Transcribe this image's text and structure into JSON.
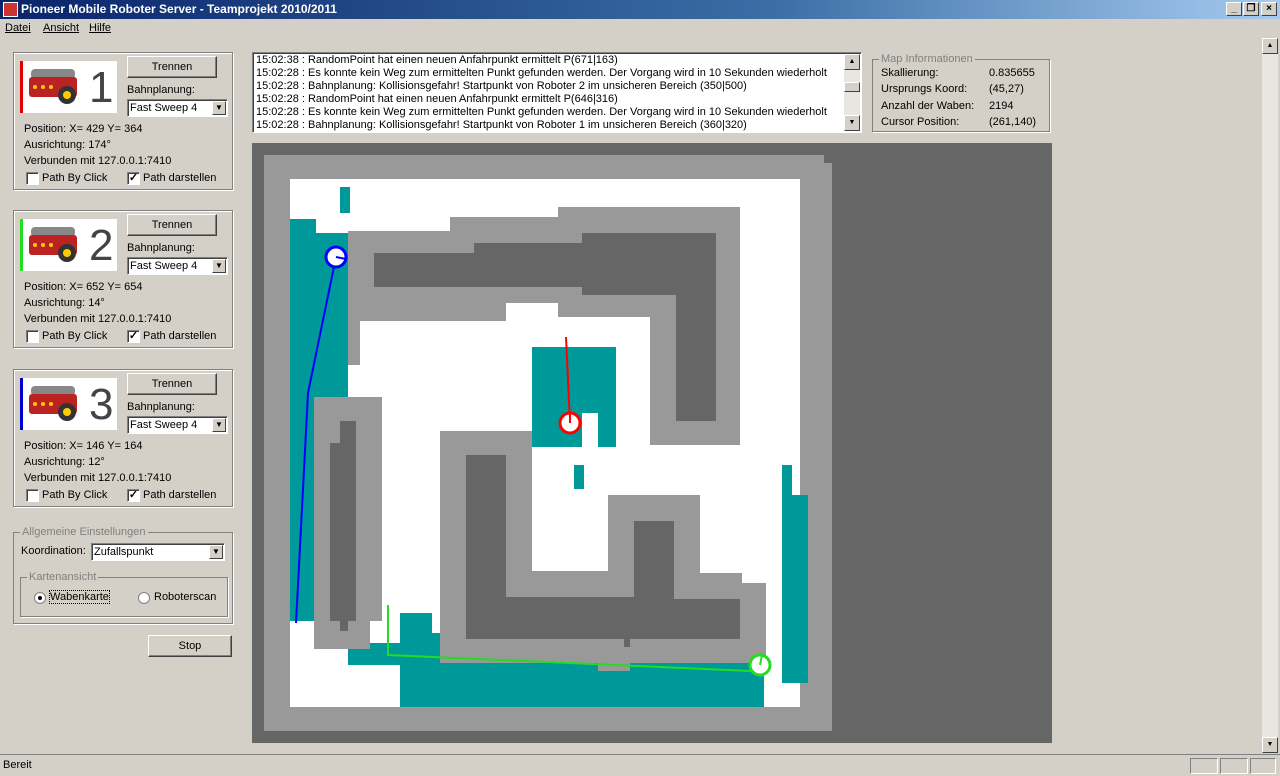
{
  "window": {
    "title": "Pioneer Mobile Roboter Server - Teamprojekt 2010/2011"
  },
  "menu": [
    "Datei",
    "Ansicht",
    "Hilfe"
  ],
  "robots": [
    {
      "number": "1",
      "color": "#e00000",
      "disconnect_label": "Trennen",
      "planning_label": "Bahnplanung:",
      "planning_value": "Fast Sweep 4",
      "position": "Position: X= 429 Y= 364",
      "orientation": "Ausrichtung: 174°",
      "connection": "Verbunden mit 127.0.0.1:7410",
      "path_by_click_label": "Path By Click",
      "path_by_click_checked": false,
      "path_show_label": "Path darstellen",
      "path_show_checked": true
    },
    {
      "number": "2",
      "color": "#22dd22",
      "disconnect_label": "Trennen",
      "planning_label": "Bahnplanung:",
      "planning_value": "Fast Sweep 4",
      "position": "Position: X= 652 Y= 654",
      "orientation": "Ausrichtung: 14°",
      "connection": "Verbunden mit 127.0.0.1:7410",
      "path_by_click_label": "Path By Click",
      "path_by_click_checked": false,
      "path_show_label": "Path darstellen",
      "path_show_checked": true
    },
    {
      "number": "3",
      "color": "#0000cc",
      "disconnect_label": "Trennen",
      "planning_label": "Bahnplanung:",
      "planning_value": "Fast Sweep 4",
      "position": "Position: X= 146 Y= 164",
      "orientation": "Ausrichtung: 12°",
      "connection": "Verbunden mit 127.0.0.1:7410",
      "path_by_click_label": "Path By Click",
      "path_by_click_checked": false,
      "path_show_label": "Path darstellen",
      "path_show_checked": true
    }
  ],
  "settings": {
    "group_label": "Allgemeine Einstellungen",
    "coordination_label": "Koordination:",
    "coordination_value": "Zufallspunkt",
    "map_view_label": "Kartenansicht",
    "option_honeycomb": "Wabenkarte",
    "option_robotscan": "Roboterscan",
    "selected": "Wabenkarte",
    "stop_label": "Stop"
  },
  "log": [
    "15:02:38 : RandomPoint hat einen neuen Anfahrpunkt ermittelt P(671|163)",
    "15:02:28 : Es konnte kein Weg zum ermittelten Punkt gefunden werden. Der Vorgang wird in 10 Sekunden wiederholt",
    "15:02:28 : Bahnplanung: Kollisionsgefahr! Startpunkt von Roboter 2 im unsicheren Bereich (350|500)",
    "15:02:28 : RandomPoint hat einen neuen Anfahrpunkt ermittelt P(646|316)",
    "15:02:28 : Es konnte kein Weg zum ermittelten Punkt gefunden werden. Der Vorgang wird in 10 Sekunden wiederholt",
    "15:02:28 : Bahnplanung: Kollisionsgefahr! Startpunkt von Roboter 1 im unsicheren Bereich (360|320)"
  ],
  "map_info": {
    "title": "Map Informationen",
    "rows": [
      {
        "key": "Skallierung:",
        "value": "0.835655"
      },
      {
        "key": "Ursprungs Koord:",
        "value": "(45,27)"
      },
      {
        "key": "Anzahl der Waben:",
        "value": "2194"
      },
      {
        "key": "Cursor Position:",
        "value": "(261,140)"
      }
    ]
  },
  "status": {
    "text": "Bereit"
  },
  "colors": {
    "wall_dark": "#666666",
    "wall_light": "#999999",
    "explored": "#009999",
    "free": "#ffffff"
  }
}
